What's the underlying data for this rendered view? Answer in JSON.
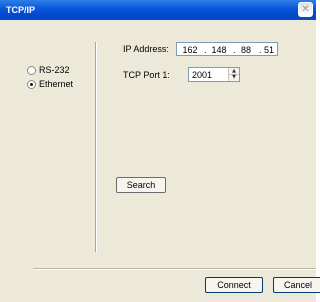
{
  "window": {
    "title": "TCP/IP",
    "close_glyph": "✕"
  },
  "connection_type": {
    "options": [
      {
        "label": "RS-232",
        "selected": false
      },
      {
        "label": "Ethernet",
        "selected": true
      }
    ]
  },
  "ip_address": {
    "label": "IP Address:",
    "octets": [
      "162",
      "148",
      "88",
      "51"
    ],
    "separator": "."
  },
  "tcp_port": {
    "label": "TCP Port 1:",
    "value": "2001",
    "spin_up": "▲",
    "spin_down": "▼"
  },
  "buttons": {
    "search": "Search",
    "connect": "Connect",
    "cancel": "Cancel"
  }
}
